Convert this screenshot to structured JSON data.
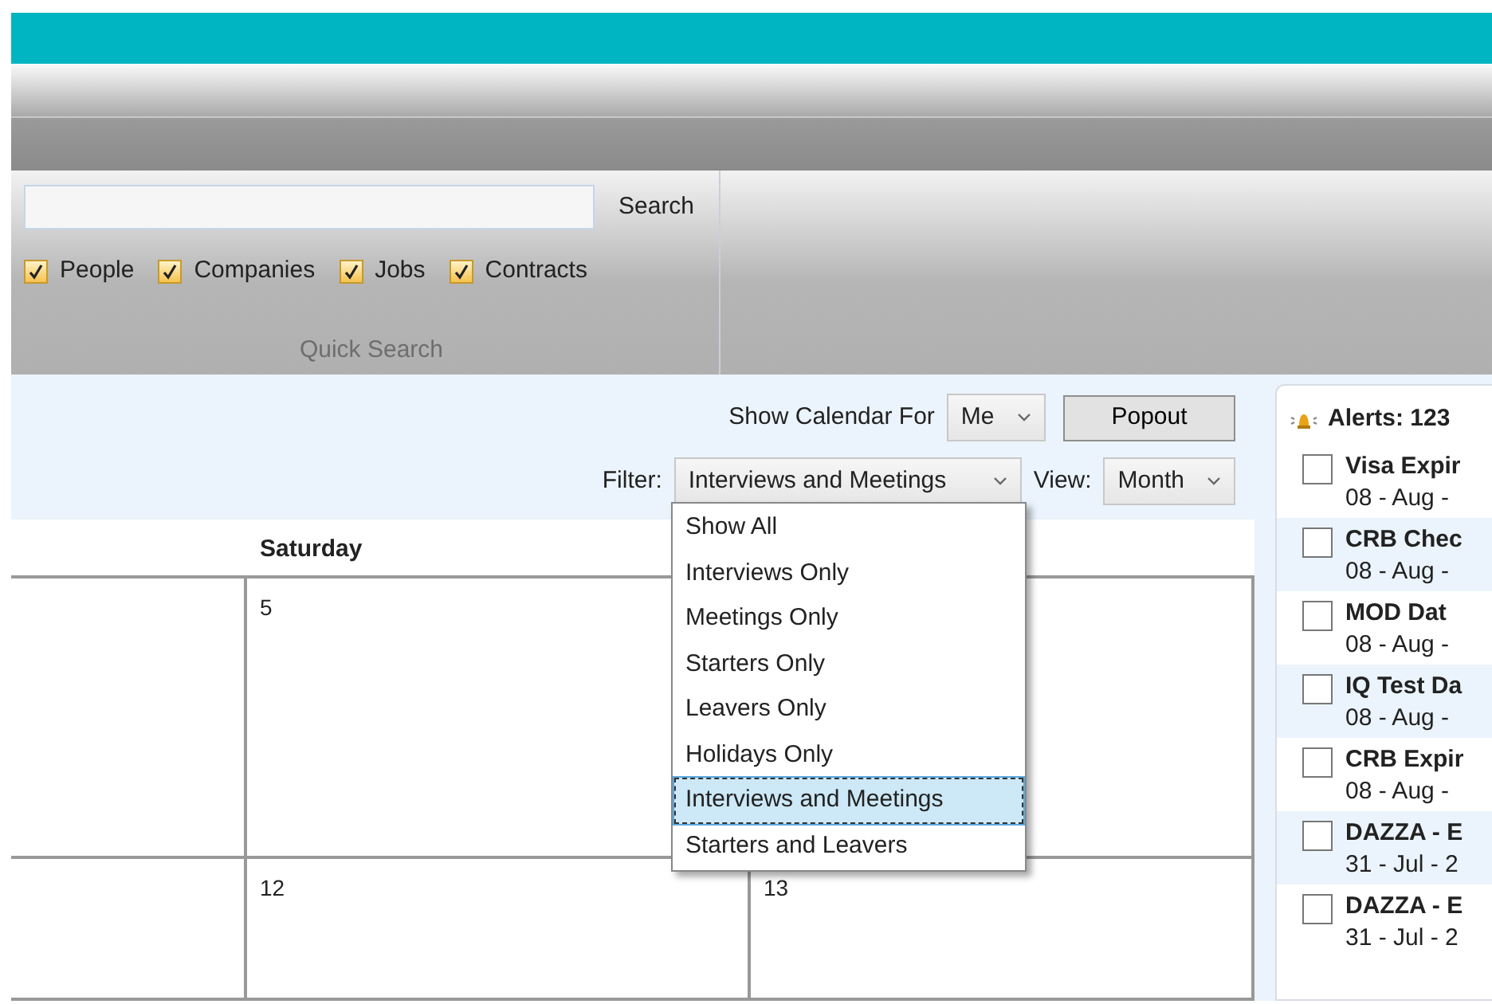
{
  "quick_search": {
    "search_button": "Search",
    "filters": [
      {
        "label": "People",
        "checked": true
      },
      {
        "label": "Companies",
        "checked": true
      },
      {
        "label": "Jobs",
        "checked": true
      },
      {
        "label": "Contracts",
        "checked": true
      }
    ],
    "group_label": "Quick Search"
  },
  "calendar_toolbar": {
    "show_for_label": "Show Calendar For",
    "show_for_value": "Me",
    "popout_button": "Popout",
    "filter_label": "Filter:",
    "filter_value": "Interviews and Meetings",
    "view_label": "View:",
    "view_value": "Month"
  },
  "filter_dropdown": [
    {
      "label": "Show All",
      "selected": false
    },
    {
      "label": "Interviews Only",
      "selected": false
    },
    {
      "label": "Meetings Only",
      "selected": false
    },
    {
      "label": "Starters Only",
      "selected": false
    },
    {
      "label": "Leavers Only",
      "selected": false
    },
    {
      "label": "Holidays Only",
      "selected": false
    },
    {
      "label": "Interviews and Meetings",
      "selected": true
    },
    {
      "label": "Starters and Leavers",
      "selected": false
    }
  ],
  "calendar": {
    "headers": {
      "column_2": "Saturday"
    },
    "weeks": [
      {
        "column_2": "5"
      },
      {
        "column_2": "12",
        "column_3": "13"
      }
    ]
  },
  "alerts": {
    "title": "Alerts: 123",
    "items": [
      {
        "title": "Visa Expir",
        "date": "08 - Aug -",
        "checked": false
      },
      {
        "title": "CRB Chec",
        "date": "08 - Aug -",
        "checked": false
      },
      {
        "title": "MOD Dat",
        "date": "08 - Aug -",
        "checked": false
      },
      {
        "title": "IQ Test Da",
        "date": "08 - Aug -",
        "checked": false
      },
      {
        "title": "CRB Expir",
        "date": "08 - Aug -",
        "checked": false
      },
      {
        "title": "DAZZA - E",
        "date": "31 - Jul - 2",
        "checked": false
      },
      {
        "title": "DAZZA - E",
        "date": "31 - Jul - 2",
        "checked": false
      }
    ]
  }
}
